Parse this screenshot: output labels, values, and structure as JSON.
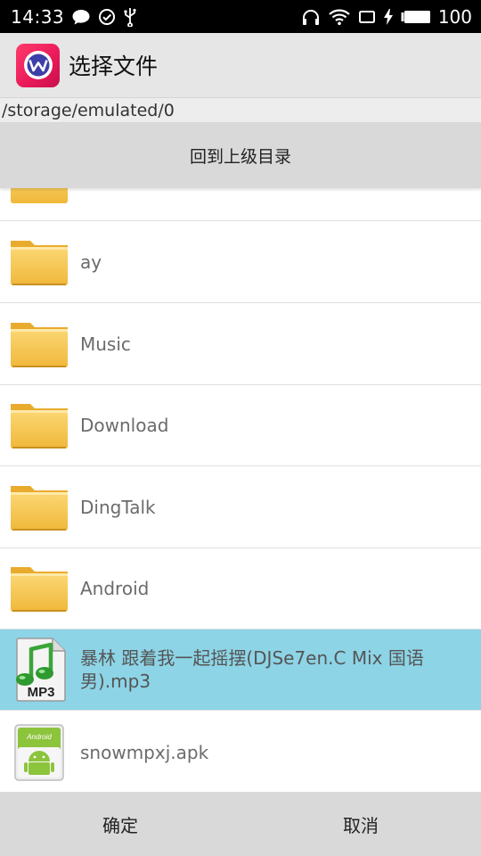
{
  "status_bar": {
    "time": "14:33",
    "battery_level": "100",
    "left_icons": [
      "chat-bubble-icon",
      "check-circle-icon",
      "usb-icon"
    ],
    "right_icons": [
      "headphones-icon",
      "wifi-icon",
      "screen-rotate-icon",
      "charging-icon",
      "battery-icon"
    ]
  },
  "title_bar": {
    "title": "选择文件",
    "app_icon": "app-logo-icon"
  },
  "path": "/storage/emulated/0",
  "up_button_label": "回到上级目录",
  "files": [
    {
      "name": "",
      "icon": "folder-icon",
      "type": "folder"
    },
    {
      "name": "ay",
      "icon": "folder-icon",
      "type": "folder"
    },
    {
      "name": "Music",
      "icon": "folder-icon",
      "type": "folder"
    },
    {
      "name": "Download",
      "icon": "folder-icon",
      "type": "folder"
    },
    {
      "name": "DingTalk",
      "icon": "folder-icon",
      "type": "folder"
    },
    {
      "name": "Android",
      "icon": "folder-icon",
      "type": "folder"
    },
    {
      "name": "暴林 跟着我一起摇摆(DJSe7en.C Mix 国语男).mp3",
      "icon": "mp3-file-icon",
      "type": "mp3",
      "selected": true
    },
    {
      "name": "snowmpxj.apk",
      "icon": "apk-file-icon",
      "type": "apk"
    }
  ],
  "buttons": {
    "confirm": "确定",
    "cancel": "取消"
  },
  "colors": {
    "selected_row": "#8dd4e6",
    "app_icon": "#e8195a",
    "folder": "#f5c64a"
  }
}
